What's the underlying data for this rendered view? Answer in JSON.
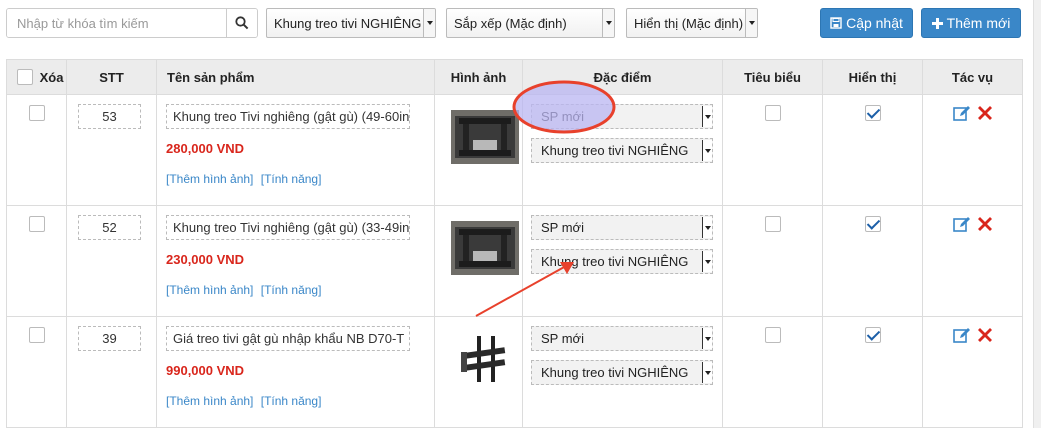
{
  "toolbar": {
    "search_placeholder": "Nhập từ khóa tìm kiếm",
    "category_filter": "Khung treo tivi NGHIÊNG",
    "sort_select": "Sắp xếp (Mặc định)",
    "display_select": "Hiển thị (Mặc định)",
    "update_label": "Cập nhật",
    "add_label": "Thêm mới"
  },
  "table": {
    "headers": {
      "delete": "Xóa",
      "stt": "STT",
      "name": "Tên sản phẩm",
      "image": "Hình ảnh",
      "feature": "Đặc điểm",
      "featured": "Tiêu biểu",
      "visible": "Hiển thị",
      "actions": "Tác vụ"
    },
    "add_image_link": "[Thêm hình ảnh]",
    "features_link": "[Tính năng]",
    "rows": [
      {
        "stt": "53",
        "name": "Khung treo Tivi nghiêng (gật gù) (49-60in",
        "price": "280,000 VND",
        "feature_type": "SP mới",
        "feature_category": "Khung treo tivi NGHIÊNG",
        "featured": false,
        "visible": true
      },
      {
        "stt": "52",
        "name": "Khung treo Tivi nghiêng (gật gù) (33-49in",
        "price": "230,000 VND",
        "feature_type": "SP mới",
        "feature_category": "Khung treo tivi NGHIÊNG",
        "featured": false,
        "visible": true
      },
      {
        "stt": "39",
        "name": "Giá treo tivi gật gù nhập khẩu NB D70-T",
        "price": "990,000 VND",
        "feature_type": "SP mới",
        "feature_category": "Khung treo tivi NGHIÊNG",
        "featured": false,
        "visible": true
      }
    ]
  },
  "colors": {
    "primary": "#3a87c8",
    "price": "#d9261c",
    "annotation": "#e8412c",
    "highlight": "#b9b5f2",
    "delete_icon": "#d9261c",
    "edit_icon": "#3a87c8"
  }
}
